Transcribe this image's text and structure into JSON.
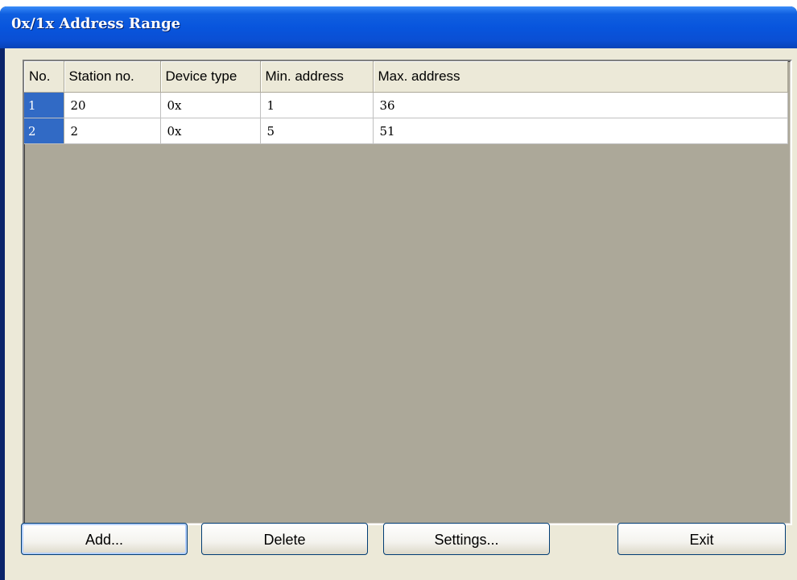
{
  "window": {
    "title": "0x/1x Address Range"
  },
  "table": {
    "columns": [
      "No.",
      "Station no.",
      "Device type",
      "Min. address",
      "Max. address"
    ],
    "rows": [
      {
        "no": "1",
        "station": "20",
        "device": "0x",
        "min": "1",
        "max": "36"
      },
      {
        "no": "2",
        "station": "2",
        "device": "0x",
        "min": "5",
        "max": "51"
      }
    ]
  },
  "buttons": {
    "add": "Add...",
    "delete": "Delete",
    "settings": "Settings...",
    "exit": "Exit"
  }
}
